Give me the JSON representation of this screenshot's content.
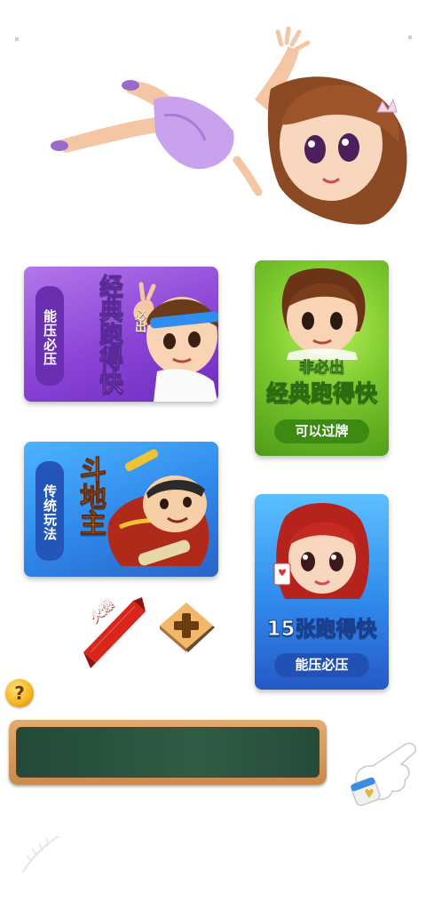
{
  "colors": {
    "purple_card": "#8a43d6",
    "green_card": "#7cc82d",
    "blue_card": "#2f87ea",
    "gold": "#f6b21d",
    "board_frame": "#d39a5c",
    "board_surface": "#2a5440",
    "hot_red": "#d8261d"
  },
  "modes": [
    {
      "id": "classic_must",
      "badge": "必出",
      "title": "经典跑得快",
      "tag": "能压必压",
      "character": "boy-with-headband"
    },
    {
      "id": "classic_not_must",
      "subtitle": "非必出",
      "title": "经典跑得快",
      "tag": "可以过牌",
      "character": "boy-brown-hair"
    },
    {
      "id": "landlord",
      "title": "斗地主",
      "tag": "传统玩法",
      "character": "landlord-man"
    },
    {
      "id": "fifteen",
      "title": "15张跑得快",
      "tag": "能压必压",
      "character": "red-hair-girl"
    }
  ],
  "hot_ribbon": {
    "label": "火爆"
  },
  "help": {
    "label": "?"
  },
  "input": {
    "value": ""
  },
  "icons": {
    "hero": "girl-character-icon",
    "plus": "plus-icon",
    "hand": "pointing-hand-icon",
    "feather": "feather-icon"
  }
}
